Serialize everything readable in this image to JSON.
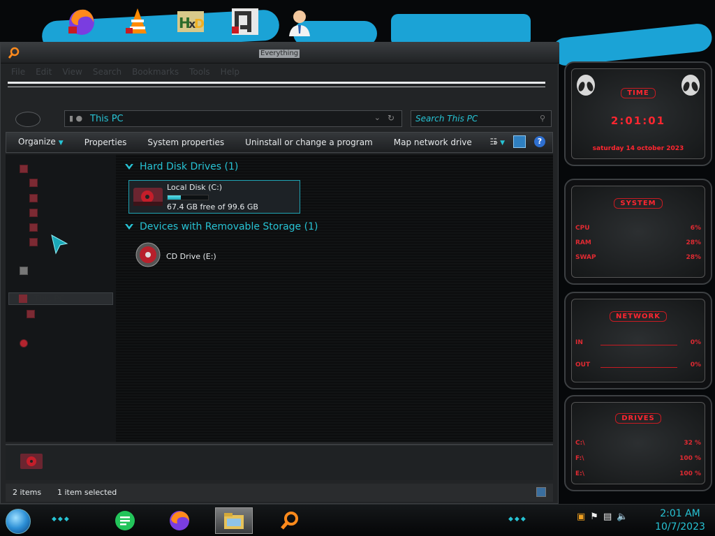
{
  "window": {
    "title": "Everything",
    "menu": [
      "File",
      "Edit",
      "View",
      "Search",
      "Bookmarks",
      "Tools",
      "Help"
    ]
  },
  "address": {
    "path": "This PC",
    "search_placeholder": "Search This PC"
  },
  "toolbar": {
    "organize": "Organize",
    "properties": "Properties",
    "system_properties": "System properties",
    "uninstall": "Uninstall or change a program",
    "map_drive": "Map network drive",
    "more": "»"
  },
  "nav": {
    "selected": "This PC"
  },
  "content": {
    "group_hdd": "Hard Disk Drives (1)",
    "group_removable": "Devices with Removable Storage (1)",
    "drive_c": {
      "name": "Local Disk (C:)",
      "free_text": "67.4 GB free of 99.6 GB",
      "used_fraction": 0.32
    },
    "drive_e": {
      "name": "CD Drive (E:)"
    }
  },
  "status": {
    "items": "2 items",
    "selected": "1 item selected"
  },
  "gadgets": {
    "time": {
      "title": "TIME",
      "clock": "2:01:01",
      "date": "saturday 14 october 2023"
    },
    "system": {
      "title": "SYSTEM",
      "rows": [
        {
          "label": "CPU",
          "value": "6%"
        },
        {
          "label": "RAM",
          "value": "28%"
        },
        {
          "label": "SWAP",
          "value": "28%"
        }
      ]
    },
    "network": {
      "title": "NETWORK",
      "rows": [
        {
          "label": "IN",
          "value": "0%"
        },
        {
          "label": "OUT",
          "value": "0%"
        }
      ]
    },
    "drives": {
      "title": "DRIVES",
      "rows": [
        {
          "label": "C:\\",
          "value": "32 %"
        },
        {
          "label": "F:\\",
          "value": "100 %"
        },
        {
          "label": "E:\\",
          "value": "100 %"
        }
      ]
    }
  },
  "taskbar": {
    "time": "2:01 AM",
    "date": "10/7/2023"
  },
  "colors": {
    "accent": "#27c3d4",
    "gadget_red": "#ff2630",
    "wallpaper_blue": "#1ba3d6"
  }
}
